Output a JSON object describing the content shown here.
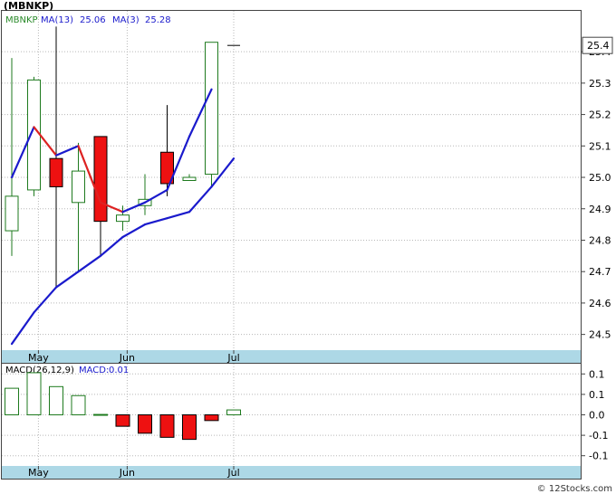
{
  "ticker_title": "(MBNKP)",
  "watermark": "© 12Stocks.com",
  "colors": {
    "up": "#1e7a1e",
    "down_fill": "#ee1111",
    "ma_fast": "#dd2222",
    "ma_slow": "#1a1acc",
    "axis_band": "#add8e6",
    "grid": "#b8b8b8",
    "ticker_label": "#2a8a2a",
    "legend_blue": "#1a1acc"
  },
  "chart_data": [
    {
      "type": "candlestick",
      "title": "(MBNKP)",
      "legend": [
        {
          "label": "MBNKP",
          "value": ""
        },
        {
          "label": "MA(13)",
          "value": "25.06"
        },
        {
          "label": "MA(3)",
          "value": "25.28"
        }
      ],
      "x_tick_labels": [
        {
          "label": "May",
          "index": 1.2
        },
        {
          "label": "Jun",
          "index": 5.2
        },
        {
          "label": "Jul",
          "index": 10.0
        }
      ],
      "ylim": [
        24.45,
        25.53
      ],
      "y_ticks": [
        24.5,
        24.6,
        24.7,
        24.8,
        24.9,
        25.0,
        25.1,
        25.2,
        25.3,
        25.4
      ],
      "last_price_label": "25.4",
      "last_price": 25.42,
      "candles": [
        {
          "open": 24.83,
          "high": 25.38,
          "low": 24.75,
          "close": 24.94
        },
        {
          "open": 24.96,
          "high": 25.32,
          "low": 24.94,
          "close": 25.31
        },
        {
          "open": 25.06,
          "high": 25.48,
          "low": 24.65,
          "close": 24.97
        },
        {
          "open": 24.92,
          "high": 25.11,
          "low": 24.7,
          "close": 25.02
        },
        {
          "open": 25.13,
          "high": 25.13,
          "low": 24.75,
          "close": 24.86
        },
        {
          "open": 24.86,
          "high": 24.91,
          "low": 24.83,
          "close": 24.88
        },
        {
          "open": 24.91,
          "high": 25.01,
          "low": 24.88,
          "close": 24.93
        },
        {
          "open": 25.08,
          "high": 25.23,
          "low": 24.94,
          "close": 24.98
        },
        {
          "open": 24.99,
          "high": 25.01,
          "low": 24.99,
          "close": 25.0
        },
        {
          "open": 25.01,
          "high": 25.43,
          "low": 24.97,
          "close": 25.43
        },
        {
          "open": 25.42,
          "high": 25.42,
          "low": 25.42,
          "close": 25.42
        }
      ],
      "ma_fast": {
        "name": "MA(3)",
        "values": [
          25.0,
          25.16,
          25.07,
          25.1,
          24.92,
          24.89,
          24.92,
          24.96,
          25.13,
          25.28
        ]
      },
      "ma_slow": {
        "name": "MA(13)",
        "values": [
          24.47,
          24.57,
          24.65,
          24.7,
          24.75,
          24.81,
          24.85,
          24.87,
          24.89,
          24.97,
          25.06
        ]
      }
    },
    {
      "type": "bar",
      "legend": [
        {
          "label": "MACD(26,12,9)",
          "value": ""
        },
        {
          "label": "MACD:",
          "value": "0.01"
        }
      ],
      "x_tick_labels": [
        {
          "label": "May",
          "index": 1.2
        },
        {
          "label": "Jun",
          "index": 5.2
        },
        {
          "label": "Jul",
          "index": 10.0
        }
      ],
      "ylim": [
        -0.125,
        0.125
      ],
      "y_tick_labels": [
        "0.1",
        "0.1",
        "0.0",
        "-0.1",
        "-0.1"
      ],
      "y_tick_values": [
        0.1,
        0.05,
        0.0,
        -0.05,
        -0.1
      ],
      "values": [
        0.065,
        0.103,
        0.069,
        0.047,
        0.001,
        -0.028,
        -0.045,
        -0.055,
        -0.06,
        -0.014,
        0.012
      ]
    }
  ]
}
